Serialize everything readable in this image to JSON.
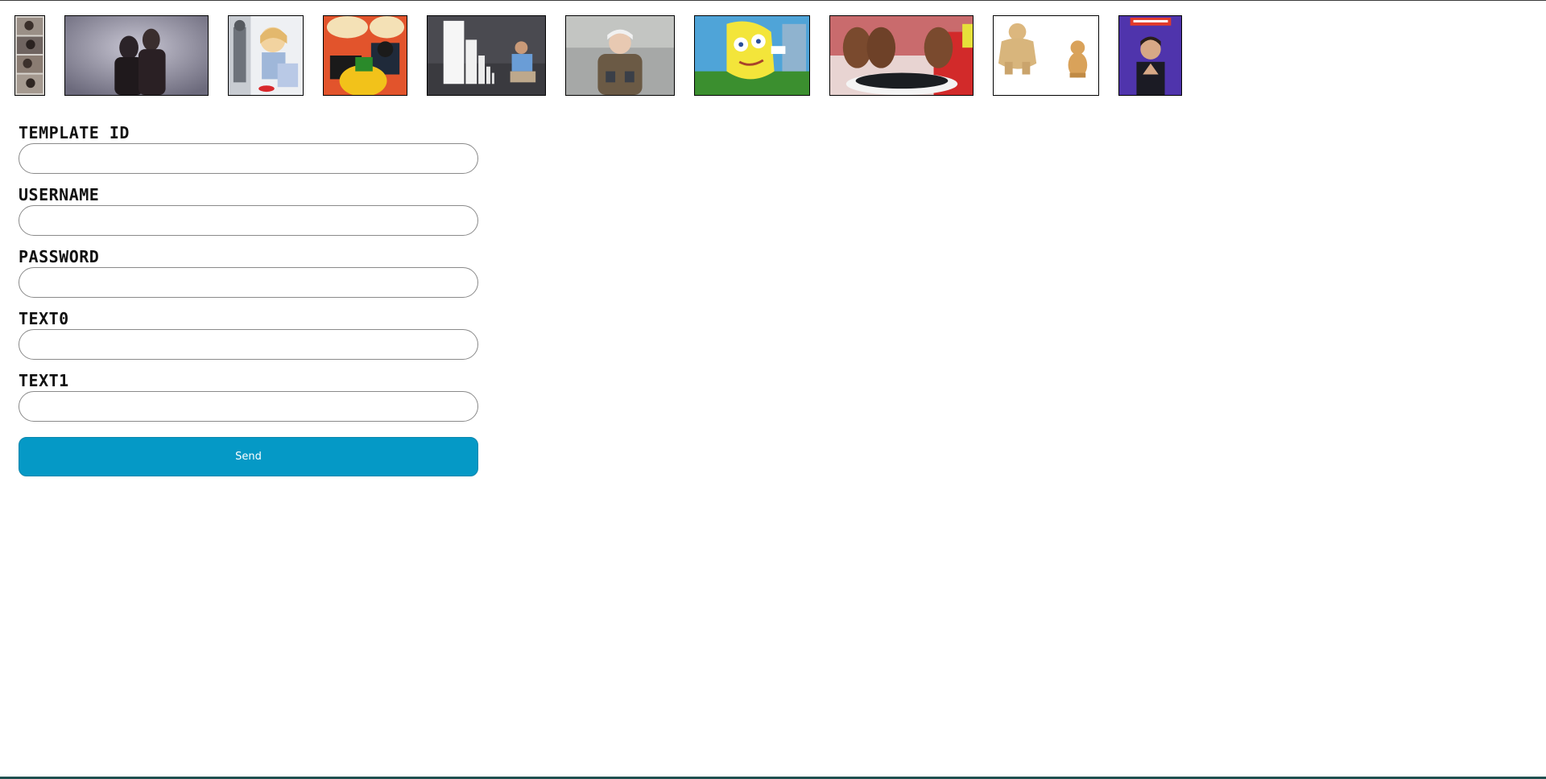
{
  "templates": [
    {
      "name": "multi-panel-reaction-meme"
    },
    {
      "name": "couple-dark-room-meme"
    },
    {
      "name": "anime-girl-robot-meme"
    },
    {
      "name": "batman-slapping-robin-meme"
    },
    {
      "name": "domino-effect-meme"
    },
    {
      "name": "bernie-mittens-meme"
    },
    {
      "name": "mocking-spongebob-meme"
    },
    {
      "name": "monkey-puppet-trio-meme"
    },
    {
      "name": "swole-doge-vs-cheems-meme"
    },
    {
      "name": "trade-offer-meme"
    }
  ],
  "form": {
    "fields": [
      {
        "label": "TEMPLATE ID",
        "value": "",
        "placeholder": ""
      },
      {
        "label": "USERNAME",
        "value": "",
        "placeholder": ""
      },
      {
        "label": "PASSWORD",
        "value": "",
        "placeholder": ""
      },
      {
        "label": "TEXT0",
        "value": "",
        "placeholder": ""
      },
      {
        "label": "TEXT1",
        "value": "",
        "placeholder": ""
      }
    ],
    "send_label": "Send"
  },
  "colors": {
    "button_bg": "#0599c6",
    "button_text": "#ffffff",
    "input_border": "#8a8a8a"
  }
}
